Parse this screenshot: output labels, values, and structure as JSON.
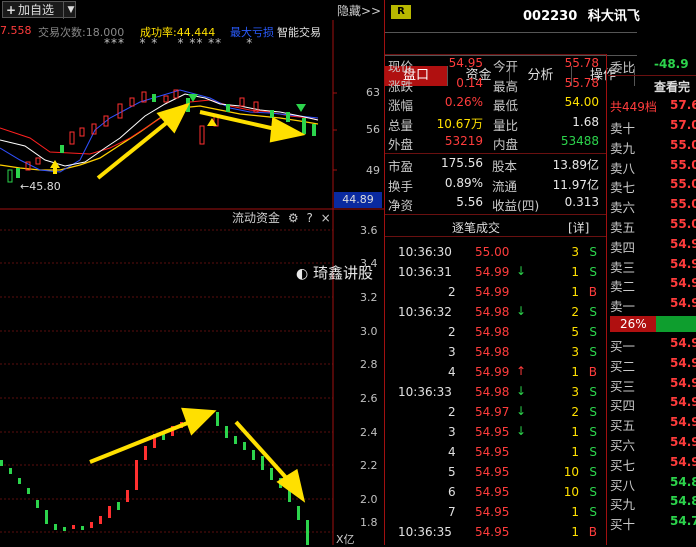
{
  "toolbar": {
    "add_label": "加自选",
    "hide_label": "隐藏>>"
  },
  "stats": {
    "left_value": "7.558",
    "trades_label": "交易次数:18.000",
    "success_label": "成功率:44.444",
    "loss_label": "最大亏损",
    "smart_label": "智能交易"
  },
  "markers": {
    "stars_row": "*** ** * ** ** *"
  },
  "kline_axis": [
    "63",
    "56",
    "49"
  ],
  "kline_low_label": "45.80",
  "current_price_tag": "44.89",
  "flow": {
    "title": "流动资金",
    "axis": [
      "3.6",
      "3.4",
      "3.2",
      "3.0",
      "2.8",
      "2.6",
      "2.4",
      "2.2",
      "2.0",
      "1.8"
    ],
    "unit": "X亿"
  },
  "watermark": "琦鑫讲股",
  "header": {
    "r_badge": "R",
    "code": "002230",
    "name": "科大讯飞"
  },
  "tabs": [
    "盘口",
    "资金",
    "分析",
    "操作"
  ],
  "quote": [
    {
      "l1": "现价",
      "v1": "54.95",
      "c1": "red",
      "l2": "今开",
      "v2": "55.78",
      "c2": "red"
    },
    {
      "l1": "涨跌",
      "v1": "0.14",
      "c1": "red",
      "l2": "最高",
      "v2": "55.78",
      "c2": "red"
    },
    {
      "l1": "涨幅",
      "v1": "0.26%",
      "c1": "red",
      "l2": "最低",
      "v2": "54.00",
      "c2": "yellow"
    },
    {
      "l1": "总量",
      "v1": "10.67万",
      "c1": "yellow",
      "l2": "量比",
      "v2": "1.68",
      "c2": "white"
    },
    {
      "l1": "外盘",
      "v1": "53219",
      "c1": "red",
      "l2": "内盘",
      "v2": "53488",
      "c2": "green"
    }
  ],
  "quote2": [
    {
      "l1": "市盈",
      "v1": "175.56",
      "l2": "股本",
      "v2": "13.89亿"
    },
    {
      "l1": "换手",
      "v1": "0.89%",
      "l2": "流通",
      "v2": "11.97亿"
    },
    {
      "l1": "净资",
      "v1": "5.56",
      "l2": "收益(四)",
      "v2": "0.313"
    }
  ],
  "ticks_header": {
    "title": "逐笔成交",
    "detail": "[详]"
  },
  "ticks": [
    {
      "t": "10:36:30",
      "p": "55.00",
      "a": "",
      "q": "3",
      "s": "S"
    },
    {
      "t": "10:36:31",
      "p": "54.99",
      "a": "down",
      "q": "1",
      "s": "S"
    },
    {
      "t": "2",
      "p": "54.99",
      "a": "",
      "q": "1",
      "s": "B"
    },
    {
      "t": "10:36:32",
      "p": "54.98",
      "a": "down",
      "q": "2",
      "s": "S"
    },
    {
      "t": "2",
      "p": "54.98",
      "a": "",
      "q": "5",
      "s": "S"
    },
    {
      "t": "3",
      "p": "54.98",
      "a": "",
      "q": "3",
      "s": "S"
    },
    {
      "t": "4",
      "p": "54.99",
      "a": "up",
      "q": "1",
      "s": "B"
    },
    {
      "t": "10:36:33",
      "p": "54.98",
      "a": "down",
      "q": "3",
      "s": "S"
    },
    {
      "t": "2",
      "p": "54.97",
      "a": "down",
      "q": "2",
      "s": "S"
    },
    {
      "t": "3",
      "p": "54.95",
      "a": "down",
      "q": "1",
      "s": "S"
    },
    {
      "t": "4",
      "p": "54.95",
      "a": "",
      "q": "1",
      "s": "S"
    },
    {
      "t": "5",
      "p": "54.95",
      "a": "",
      "q": "10",
      "s": "S"
    },
    {
      "t": "6",
      "p": "54.95",
      "a": "",
      "q": "10",
      "s": "S"
    },
    {
      "t": "7",
      "p": "54.95",
      "a": "",
      "q": "1",
      "s": "S"
    },
    {
      "t": "10:36:35",
      "p": "54.95",
      "a": "",
      "q": "1",
      "s": "B"
    }
  ],
  "book": {
    "wb_label": "委比",
    "wb_value": "-48.9",
    "title": "查看完",
    "total_label": "共449档",
    "total_value": "57.6",
    "sells": [
      {
        "l": "卖十",
        "v": "57.0"
      },
      {
        "l": "卖九",
        "v": "55.0"
      },
      {
        "l": "卖八",
        "v": "55.0"
      },
      {
        "l": "卖七",
        "v": "55.0"
      },
      {
        "l": "卖六",
        "v": "55.0"
      },
      {
        "l": "卖五",
        "v": "55.0"
      },
      {
        "l": "卖四",
        "v": "54.9"
      },
      {
        "l": "卖三",
        "v": "54.9"
      },
      {
        "l": "卖二",
        "v": "54.9"
      },
      {
        "l": "卖一",
        "v": "54.9"
      }
    ],
    "pct": "26%",
    "buys": [
      {
        "l": "买一",
        "v": "54.9"
      },
      {
        "l": "买二",
        "v": "54.9"
      },
      {
        "l": "买三",
        "v": "54.9"
      },
      {
        "l": "买四",
        "v": "54.9"
      },
      {
        "l": "买五",
        "v": "54.9"
      },
      {
        "l": "买六",
        "v": "54.9"
      },
      {
        "l": "买七",
        "v": "54.9"
      },
      {
        "l": "买八",
        "v": "54.8"
      },
      {
        "l": "买九",
        "v": "54.8"
      },
      {
        "l": "买十",
        "v": "54.7"
      }
    ]
  }
}
